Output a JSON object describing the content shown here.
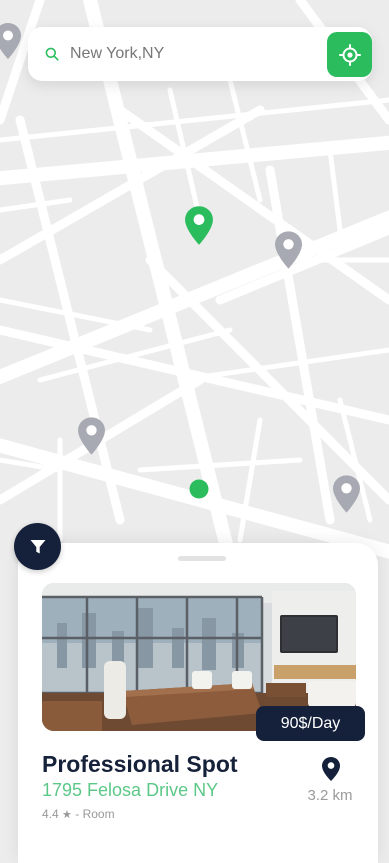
{
  "search": {
    "value": "New York,NY"
  },
  "listing": {
    "price": "90$/Day",
    "title": "Professional Spot",
    "address": "1795 Felosa Drive NY",
    "rating": "4.4",
    "rating_icon": "star-icon",
    "type": "Room",
    "separator": "-",
    "distance": "3.2 km"
  },
  "colors": {
    "accent": "#2bbd5d",
    "dark": "#15213a",
    "pin_gray": "#a7aab2",
    "address_green": "#5cc888"
  }
}
